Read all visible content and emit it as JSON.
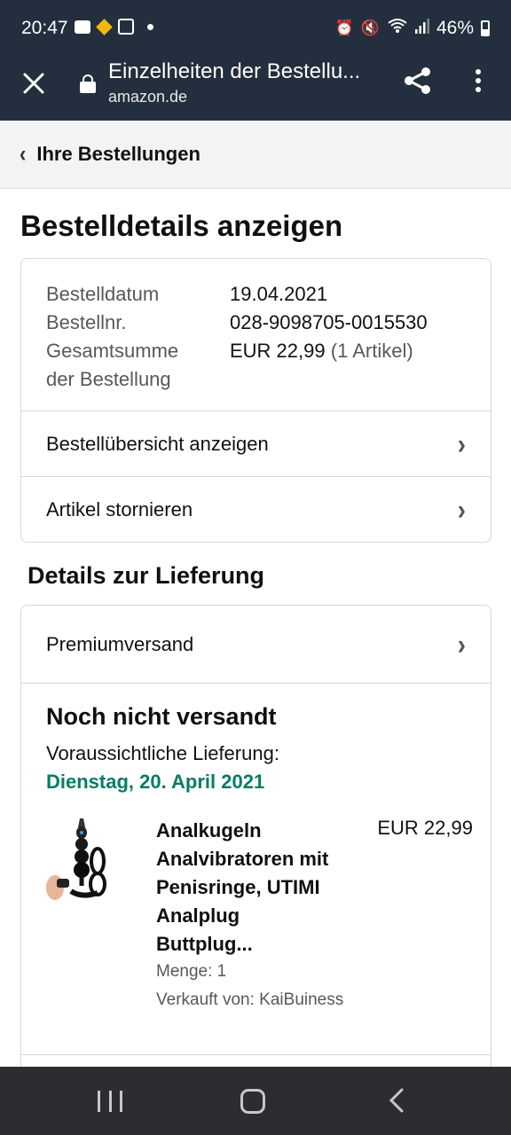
{
  "status_bar": {
    "time": "20:47",
    "battery": "46%",
    "battery_level": 0.46,
    "left_icons": [
      "message-icon",
      "binance-icon",
      "cards-icon",
      "dot-icon"
    ],
    "right_icons": [
      "alarm-icon",
      "mute-icon",
      "wifi-icon",
      "signal-icon",
      "battery-icon"
    ]
  },
  "app_bar": {
    "title": "Einzelheiten der Bestellu...",
    "url": "amazon.de",
    "background": "#232f3e"
  },
  "breadcrumb": {
    "label": "Ihre Bestellungen"
  },
  "page": {
    "heading": "Bestelldetails anzeigen"
  },
  "order": {
    "date_label": "Bestelldatum",
    "date_value": "19.04.2021",
    "number_label": "Bestellnr.",
    "number_value": "028-9098705-0015530",
    "total_label_line1": "Gesamtsumme",
    "total_label_line2": "der Bestellung",
    "total_value": "EUR 22,99",
    "total_count": "(1 Artikel)",
    "links": {
      "summary": "Bestellübersicht anzeigen",
      "cancel": "Artikel stornieren"
    }
  },
  "delivery": {
    "heading": "Details zur Lieferung",
    "shipping_method": "Premiumversand",
    "status": "Noch nicht versandt",
    "expected_label": "Voraussichtliche Lieferung:",
    "expected_date": "Dienstag, 20. April 2021",
    "date_color": "#067d62"
  },
  "product": {
    "title_line1": "Analkugeln",
    "title_line2": "Analvibratoren mit",
    "title_line3": "Penisringe, UTIMI",
    "title_line4": "Analplug",
    "title_line5": "Buttplug...",
    "price": "EUR 22,99",
    "quantity": "Menge: 1",
    "seller": "Verkauft von: KaiBuiness"
  }
}
